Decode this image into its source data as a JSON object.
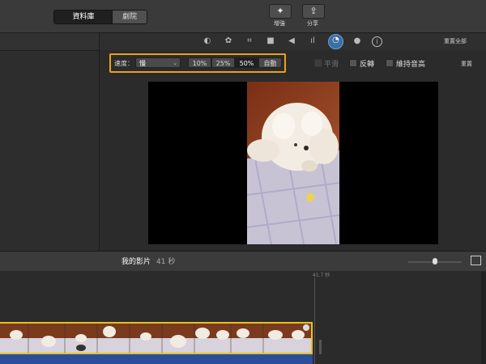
{
  "toolbar": {
    "library_label": "資料庫",
    "theater_label": "劇院",
    "enhance_label": "增強",
    "share_label": "分享"
  },
  "adjustments": {
    "reset_all_label": "重置全部",
    "icons": [
      "color-balance-icon",
      "palette-icon",
      "crop-icon",
      "stabilization-icon",
      "volume-icon",
      "equalizer-icon",
      "speed-icon",
      "filter-icon",
      "info-icon"
    ]
  },
  "speed": {
    "label": "速度：",
    "selected": "慢",
    "options": [
      "10%",
      "25%",
      "50%",
      "自動"
    ],
    "selected_option": "50%",
    "smooth_label": "平滑",
    "reverse_label": "反轉",
    "preserve_pitch_label": "維持音高",
    "reset_label": "重置"
  },
  "project": {
    "title": "我的影片",
    "duration": "41 秒"
  },
  "timeline": {
    "playhead_time": "41.7 秒"
  },
  "colors": {
    "accent_highlight": "#e8a020",
    "clip_border": "#e8c020",
    "audio": "#2a4e9a"
  }
}
